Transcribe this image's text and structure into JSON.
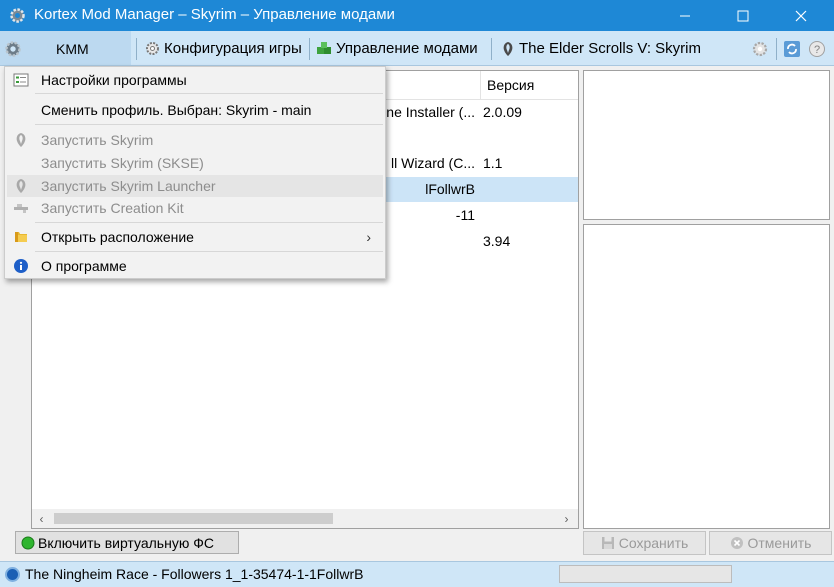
{
  "window": {
    "title": "Kortex Mod Manager – Skyrim – Управление модами"
  },
  "toolbar": {
    "kmm_label": "KMM",
    "game_config_label": "Конфигурация игры",
    "mod_management_label": "Управление модами",
    "game_label": "The Elder Scrolls V: Skyrim"
  },
  "mod_list": {
    "version_header": "Версия",
    "rows": [
      {
        "name": "ne Installer (...",
        "version": "2.0.09",
        "selected": false
      },
      {
        "name": "",
        "version": "",
        "selected": false
      },
      {
        "name": "ll Wizard (C...",
        "version": "1.1",
        "selected": false
      },
      {
        "name": "lFollwrB",
        "version": "",
        "selected": true
      },
      {
        "name": "-11",
        "version": "",
        "selected": false
      },
      {
        "name": "",
        "version": "3.94",
        "selected": false
      }
    ]
  },
  "buttons": {
    "vfs_label": "Включить виртуальную ФС",
    "save_label": "Сохранить",
    "cancel_label": "Отменить"
  },
  "status": {
    "text": "The Ningheim Race - Followers 1_1-35474-1-1FollwrB",
    "progress": 0
  },
  "menu": {
    "items": [
      {
        "label": "Настройки программы",
        "icon": "settings-list-icon",
        "enabled": true
      },
      {
        "label": "Сменить профиль. Выбран: Skyrim - main",
        "icon": "",
        "enabled": true
      },
      {
        "label": "Запустить Skyrim",
        "icon": "skyrim-icon",
        "enabled": false
      },
      {
        "label": "Запустить Skyrim (SKSE)",
        "icon": "",
        "enabled": false
      },
      {
        "label": "Запустить Skyrim Launcher",
        "icon": "skyrim-icon",
        "enabled": false
      },
      {
        "label": "Запустить Creation Kit",
        "icon": "creation-kit-icon",
        "enabled": false
      },
      {
        "label": "Открыть расположение",
        "icon": "folder-icon",
        "enabled": true,
        "submenu": true
      },
      {
        "label": "О программе",
        "icon": "info-icon",
        "enabled": true
      }
    ]
  },
  "colors": {
    "titlebar": "#1e88d6",
    "toolbar": "#cfe6f7",
    "selection": "#cce4f7",
    "status_dot": "#1a5fb4"
  }
}
